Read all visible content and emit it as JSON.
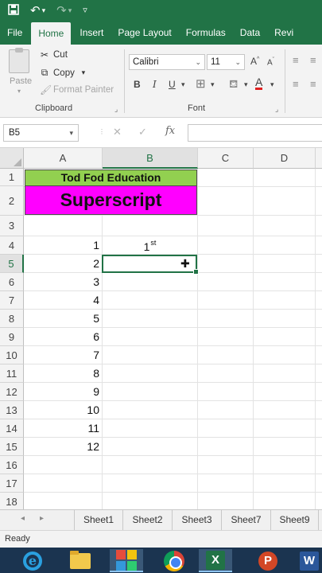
{
  "titlebar": {
    "icons": [
      "save-icon",
      "undo-icon",
      "redo-icon",
      "customize-quick-access-icon"
    ]
  },
  "tabs": [
    {
      "label": "File",
      "active": false
    },
    {
      "label": "Home",
      "active": true
    },
    {
      "label": "Insert",
      "active": false
    },
    {
      "label": "Page Layout",
      "active": false
    },
    {
      "label": "Formulas",
      "active": false
    },
    {
      "label": "Data",
      "active": false
    },
    {
      "label": "Revi",
      "active": false
    }
  ],
  "ribbon": {
    "clipboard": {
      "paste_label": "Paste",
      "cut_label": "Cut",
      "copy_label": "Copy",
      "format_painter_label": "Format Painter",
      "group_label": "Clipboard"
    },
    "font": {
      "font_name": "Calibri",
      "font_size": "11",
      "bold": "B",
      "italic": "I",
      "underline": "U",
      "font_color_letter": "A",
      "group_label": "Font"
    }
  },
  "formula_bar": {
    "name_box": "B5",
    "fx_label": "fx",
    "formula": ""
  },
  "grid": {
    "columns": [
      "A",
      "B",
      "C",
      "D"
    ],
    "selected_column": "B",
    "rows": [
      "1",
      "2",
      "3",
      "4",
      "5",
      "6",
      "7",
      "8",
      "9",
      "10",
      "11",
      "12",
      "13",
      "14",
      "15",
      "16",
      "17",
      "18"
    ],
    "selected_row": "5",
    "cells": {
      "A1": "Tod Fod Education",
      "A2": "Superscript",
      "B4_base": "1",
      "B4_superscript": "st",
      "A_values": [
        "1",
        "2",
        "3",
        "4",
        "5",
        "6",
        "7",
        "8",
        "9",
        "10",
        "11",
        "12"
      ]
    },
    "active_cell": "B5"
  },
  "sheet_tabs": [
    "Sheet1",
    "Sheet2",
    "Sheet3",
    "Sheet7",
    "Sheet9"
  ],
  "status": "Ready",
  "colors": {
    "excel_green": "#217346",
    "title_fill": "#92d050",
    "superscript_fill": "#ff00ff"
  },
  "taskbar": {
    "apps": [
      "internet-explorer-icon",
      "file-explorer-icon",
      "apps-icon",
      "chrome-icon",
      "excel-icon",
      "powerpoint-icon",
      "word-icon"
    ],
    "excel_letter": "X",
    "powerpoint_letter": "P",
    "word_letter": "W"
  }
}
